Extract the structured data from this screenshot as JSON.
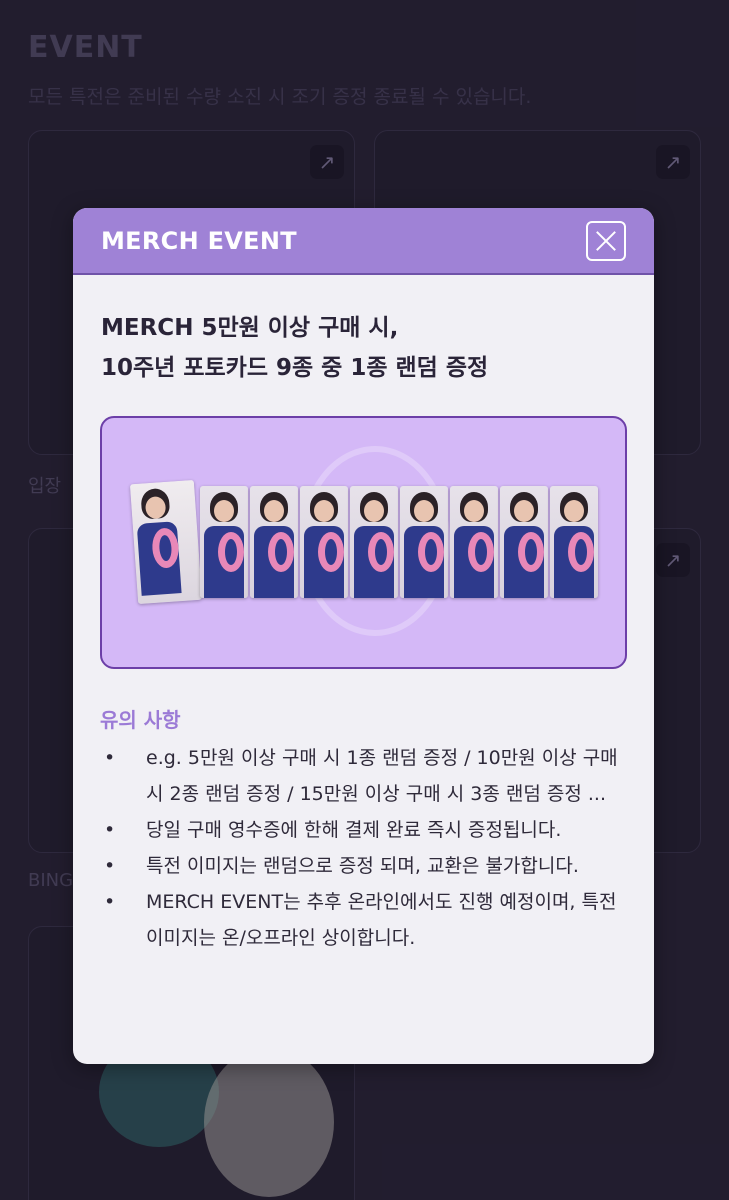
{
  "background": {
    "title": "EVENT",
    "subtitle": "모든 특전은 준비된 수량 소진 시 조기 증정 종료될 수 있습니다.",
    "label_entry": "입장",
    "label_bingo": "BING",
    "arrow_icon": "external-link-icon"
  },
  "modal": {
    "title": "MERCH EVENT",
    "close_icon": "close-icon",
    "headline_line1": "MERCH 5만원 이상 구매 시,",
    "headline_line2": "10주년 포토카드 9종 중 1종 랜덤 증정",
    "photocard_count": 9,
    "notes_title": "유의 사항",
    "notes": [
      "e.g. 5만원 이상 구매 시 1종 랜덤 증정 / 10만원 이상 구매 시 2종 랜덤 증정 / 15만원 이상 구매 시 3종 랜덤 증정 ...",
      "당일 구매 영수증에 한해 결제 완료 즉시 증정됩니다.",
      "특전 이미지는 랜덤으로 증정 되며, 교환은 불가합니다.",
      "MERCH EVENT는 추후 온라인에서도 진행 예정이며, 특전 이미지는 온/오프라인 상이합니다."
    ],
    "bullet": "•"
  },
  "colors": {
    "header": "#9f82d6",
    "promo_bg": "#d4b8f7",
    "notes_title": "#9b7ad6",
    "backdrop": "#2a2438"
  }
}
